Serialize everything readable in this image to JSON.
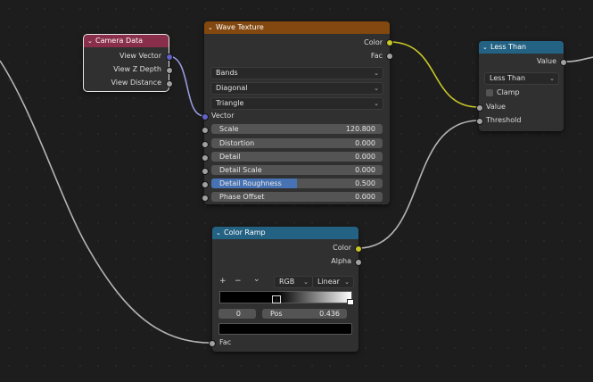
{
  "colors": {
    "camera_header": "#8a2f4b",
    "wave_header": "#82480f",
    "converter_header": "#246283",
    "socket_gray": "#a1a1a1",
    "socket_yellow": "#c7c729",
    "socket_blue": "#6363c7",
    "slider_fill": "#4772b3"
  },
  "camera_node": {
    "title": "Camera Data",
    "outputs": [
      "View Vector",
      "View Z Depth",
      "View Distance"
    ]
  },
  "wave_node": {
    "title": "Wave Texture",
    "outputs": [
      "Color",
      "Fac"
    ],
    "dropdowns": [
      "Bands",
      "Diagonal",
      "Triangle"
    ],
    "input_vector": "Vector",
    "fields": [
      {
        "label": "Scale",
        "value": "120.800"
      },
      {
        "label": "Distortion",
        "value": "0.000"
      },
      {
        "label": "Detail",
        "value": "0.000"
      },
      {
        "label": "Detail Scale",
        "value": "0.000"
      },
      {
        "label": "Detail Roughness",
        "value": "0.500",
        "fraction": 0.5
      },
      {
        "label": "Phase Offset",
        "value": "0.000"
      }
    ]
  },
  "lessthan_node": {
    "title": "Less Than",
    "output": "Value",
    "operation": "Less Than",
    "clamp_label": "Clamp",
    "clamp_checked": false,
    "inputs": [
      "Value",
      "Threshold"
    ]
  },
  "ramp_node": {
    "title": "Color Ramp",
    "outputs": [
      "Color",
      "Alpha"
    ],
    "add_btn": "+",
    "remove_btn": "−",
    "menu_btn": "⌄",
    "color_mode": "RGB",
    "interpolation": "Linear",
    "stop_index": "0",
    "pos_label": "Pos",
    "pos_value": "0.436",
    "input": "Fac"
  }
}
